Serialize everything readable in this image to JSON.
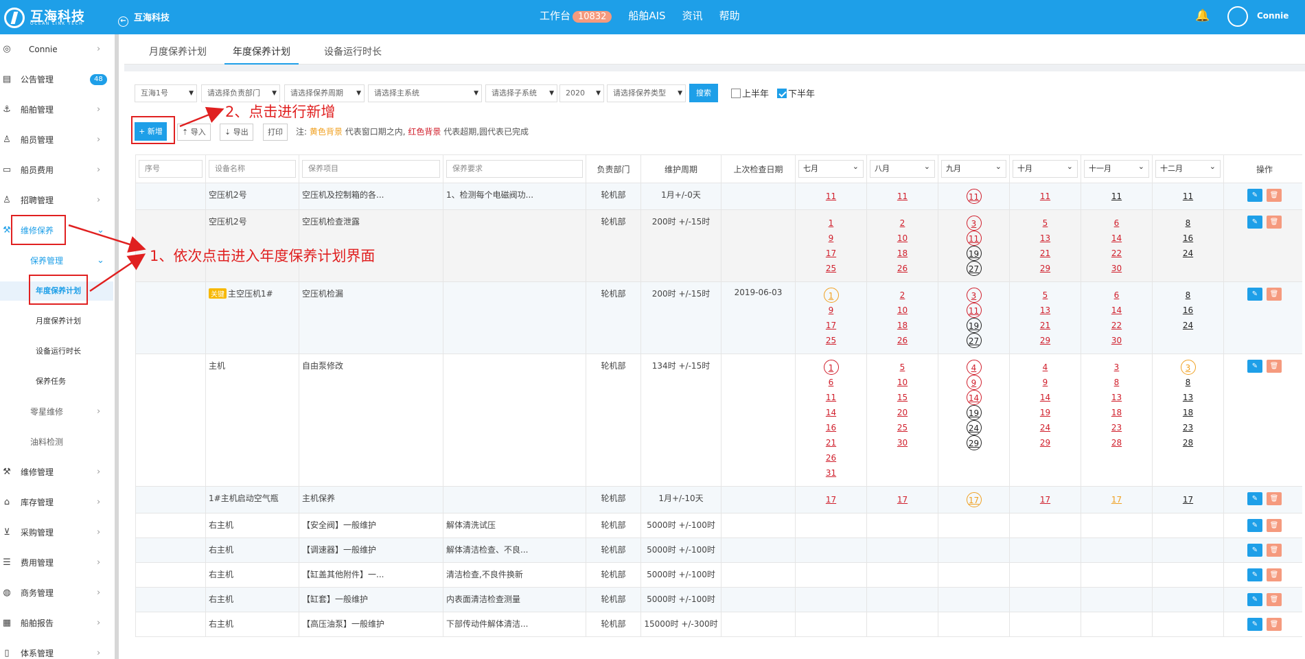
{
  "header": {
    "logo_name": "互海科技",
    "logo_sub": "OCEAN LINK TECH",
    "back_title": "互海科技",
    "nav": [
      "工作台",
      "船舶AIS",
      "资讯",
      "帮助"
    ],
    "workbench_badge": "10832",
    "user": "Connie"
  },
  "sidebar": {
    "user": "Connie",
    "items": [
      "公告管理",
      "船舶管理",
      "船员管理",
      "船员费用",
      "招聘管理",
      "维修保养",
      "保养管理",
      "年度保养计划",
      "月度保养计划",
      "设备运行时长",
      "保养任务",
      "零星维修",
      "油料检测",
      "维修管理",
      "库存管理",
      "采购管理",
      "费用管理",
      "商务管理",
      "船舶报告",
      "体系管理"
    ],
    "badge": "48"
  },
  "tabs": [
    "月度保养计划",
    "年度保养计划",
    "设备运行时长"
  ],
  "filters": {
    "ship": "互海1号",
    "dept": "请选择负责部门",
    "period": "请选择保养周期",
    "main_sys": "请选择主系统",
    "sub_sys": "请选择子系统",
    "year": "2020",
    "type": "请选择保养类型",
    "search": "搜索",
    "h1": "上半年",
    "h2": "下半年"
  },
  "toolbar": {
    "add": "+ 新增",
    "import": "导入",
    "export": "导出",
    "print": "打印",
    "note_prefix": "注:",
    "note_yellow": "黄色背景",
    "note_mid": "代表窗口期之内,",
    "note_red": "红色背景",
    "note_end": "代表超期,圆代表已完成"
  },
  "annotations": {
    "step1": "1、依次点击进入年度保养计划界面",
    "step2": "2、点击进行新增"
  },
  "table": {
    "headers": {
      "seq": "序号",
      "name": "设备名称",
      "item": "保养项目",
      "req": "保养要求",
      "dept": "负责部门",
      "cycle": "维护周期",
      "last": "上次检查日期",
      "ops": "操作"
    },
    "months": [
      "七月",
      "八月",
      "九月",
      "十月",
      "十一月",
      "十二月"
    ],
    "key_tag": "关键"
  },
  "rows": [
    {
      "name": "空压机2号",
      "item": "空压机及控制箱的各...",
      "req": "1、检测每个电磁阀功...",
      "dept": "轮机部",
      "cycle": "1月+/-0天",
      "last": "",
      "months": [
        [
          [
            "11",
            "r"
          ]
        ],
        [
          [
            "11",
            "r"
          ]
        ],
        [
          [
            "11",
            "cr"
          ]
        ],
        [
          [
            "11",
            "r"
          ]
        ],
        [
          [
            "11",
            "k"
          ]
        ],
        [
          [
            "11",
            "k"
          ]
        ]
      ]
    },
    {
      "name": "空压机2号",
      "item": "空压机检查泄露",
      "req": "",
      "dept": "轮机部",
      "cycle": "200时 +/-15时",
      "last": "",
      "months": [
        [
          [
            "1",
            "r"
          ],
          [
            "9",
            "r"
          ],
          [
            "17",
            "r"
          ],
          [
            "25",
            "r"
          ]
        ],
        [
          [
            "2",
            "r"
          ],
          [
            "10",
            "r"
          ],
          [
            "18",
            "r"
          ],
          [
            "26",
            "r"
          ]
        ],
        [
          [
            "3",
            "cr"
          ],
          [
            "11",
            "cr"
          ],
          [
            "19",
            "ck"
          ],
          [
            "27",
            "ck"
          ]
        ],
        [
          [
            "5",
            "r"
          ],
          [
            "13",
            "r"
          ],
          [
            "21",
            "r"
          ],
          [
            "29",
            "r"
          ]
        ],
        [
          [
            "6",
            "r"
          ],
          [
            "14",
            "r"
          ],
          [
            "22",
            "r"
          ],
          [
            "30",
            "r"
          ]
        ],
        [
          [
            "8",
            "k"
          ],
          [
            "16",
            "k"
          ],
          [
            "24",
            "k"
          ]
        ]
      ]
    },
    {
      "key": true,
      "name": "主空压机1#",
      "item": "空压机检漏",
      "req": "",
      "dept": "轮机部",
      "cycle": "200时 +/-15时",
      "last": "2019-06-03",
      "months": [
        [
          [
            "1",
            "co"
          ],
          [
            "9",
            "r"
          ],
          [
            "17",
            "r"
          ],
          [
            "25",
            "r"
          ]
        ],
        [
          [
            "2",
            "r"
          ],
          [
            "10",
            "r"
          ],
          [
            "18",
            "r"
          ],
          [
            "26",
            "r"
          ]
        ],
        [
          [
            "3",
            "cr"
          ],
          [
            "11",
            "cr"
          ],
          [
            "19",
            "ck"
          ],
          [
            "27",
            "ck"
          ]
        ],
        [
          [
            "5",
            "r"
          ],
          [
            "13",
            "r"
          ],
          [
            "21",
            "r"
          ],
          [
            "29",
            "r"
          ]
        ],
        [
          [
            "6",
            "r"
          ],
          [
            "14",
            "r"
          ],
          [
            "22",
            "r"
          ],
          [
            "30",
            "r"
          ]
        ],
        [
          [
            "8",
            "k"
          ],
          [
            "16",
            "k"
          ],
          [
            "24",
            "k"
          ]
        ]
      ]
    },
    {
      "name": "主机",
      "item": "自由泵修改",
      "req": "",
      "dept": "轮机部",
      "cycle": "134时 +/-15时",
      "last": "",
      "months": [
        [
          [
            "1",
            "cr"
          ],
          [
            "6",
            "r"
          ],
          [
            "11",
            "r"
          ],
          [
            "14",
            "r"
          ],
          [
            "16",
            "r"
          ],
          [
            "21",
            "r"
          ],
          [
            "26",
            "r"
          ],
          [
            "31",
            "r"
          ]
        ],
        [
          [
            "5",
            "r"
          ],
          [
            "10",
            "r"
          ],
          [
            "15",
            "r"
          ],
          [
            "20",
            "r"
          ],
          [
            "25",
            "r"
          ],
          [
            "30",
            "r"
          ]
        ],
        [
          [
            "4",
            "cr"
          ],
          [
            "9",
            "cr"
          ],
          [
            "14",
            "cr"
          ],
          [
            "19",
            "ck"
          ],
          [
            "24",
            "ck"
          ],
          [
            "29",
            "ck"
          ]
        ],
        [
          [
            "4",
            "r"
          ],
          [
            "9",
            "r"
          ],
          [
            "14",
            "r"
          ],
          [
            "19",
            "r"
          ],
          [
            "24",
            "r"
          ],
          [
            "29",
            "r"
          ]
        ],
        [
          [
            "3",
            "r"
          ],
          [
            "8",
            "r"
          ],
          [
            "13",
            "r"
          ],
          [
            "18",
            "r"
          ],
          [
            "23",
            "r"
          ],
          [
            "28",
            "r"
          ]
        ],
        [
          [
            "3",
            "co"
          ],
          [
            "8",
            "k"
          ],
          [
            "13",
            "k"
          ],
          [
            "18",
            "k"
          ],
          [
            "23",
            "k"
          ],
          [
            "28",
            "k"
          ]
        ]
      ]
    },
    {
      "name": "1#主机启动空气瓶",
      "item": "主机保养",
      "req": "",
      "dept": "轮机部",
      "cycle": "1月+/-10天",
      "last": "",
      "months": [
        [
          [
            "17",
            "r"
          ]
        ],
        [
          [
            "17",
            "r"
          ]
        ],
        [
          [
            "17",
            "co"
          ]
        ],
        [
          [
            "17",
            "r"
          ]
        ],
        [
          [
            "17",
            "o"
          ]
        ],
        [
          [
            "17",
            "k"
          ]
        ]
      ]
    },
    {
      "name": "右主机",
      "item": "【安全阀】一般维护",
      "req": "解体清洗试压",
      "dept": "轮机部",
      "cycle": "5000时 +/-100时",
      "last": "",
      "months": [
        [],
        [],
        [],
        [],
        [],
        []
      ]
    },
    {
      "name": "右主机",
      "item": "【调速器】一般维护",
      "req": "解体清洁检查、不良...",
      "dept": "轮机部",
      "cycle": "5000时 +/-100时",
      "last": "",
      "months": [
        [],
        [],
        [],
        [],
        [],
        []
      ]
    },
    {
      "name": "右主机",
      "item": "【缸盖其他附件】一...",
      "req": "清洁检查,不良件换新",
      "dept": "轮机部",
      "cycle": "5000时 +/-100时",
      "last": "",
      "months": [
        [],
        [],
        [],
        [],
        [],
        []
      ]
    },
    {
      "name": "右主机",
      "item": "【缸套】一般维护",
      "req": "内表面清洁检查测量",
      "dept": "轮机部",
      "cycle": "5000时 +/-100时",
      "last": "",
      "months": [
        [],
        [],
        [],
        [],
        [],
        []
      ]
    },
    {
      "name": "右主机",
      "item": "【高压油泵】一般维护",
      "req": "下部传动件解体清洁...",
      "dept": "轮机部",
      "cycle": "15000时 +/-300时",
      "last": "",
      "months": [
        [],
        [],
        [],
        [],
        [],
        []
      ]
    }
  ]
}
